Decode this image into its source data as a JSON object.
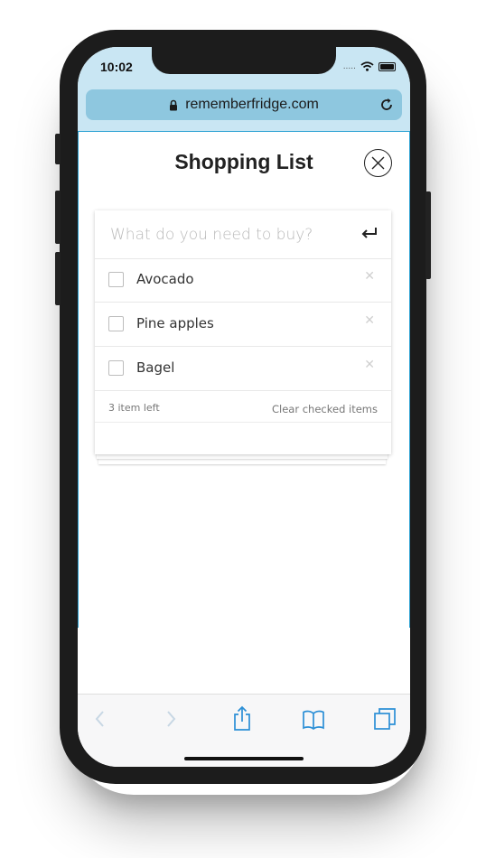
{
  "status_bar": {
    "time": "10:02",
    "signal_dots": "....."
  },
  "browser": {
    "url": "rememberfridge.com"
  },
  "app": {
    "title": "Shopping List",
    "new_item_placeholder": "What do you need to buy?",
    "items": [
      {
        "label": "Avocado",
        "checked": false
      },
      {
        "label": "Pine apples",
        "checked": false
      },
      {
        "label": "Bagel",
        "checked": false
      }
    ],
    "footer": {
      "items_left": "3 item left",
      "clear_label": "Clear checked items"
    }
  },
  "toolbar_icons": [
    "back-icon",
    "forward-icon",
    "share-icon",
    "bookmarks-icon",
    "tabs-icon"
  ],
  "colors": {
    "accent": "#2aa0d2",
    "url_bar": "#8ec7df",
    "status_bg": "#c9e6f3",
    "toolbar_icon": "#2b8fd6",
    "disabled_icon": "#c7d7e4"
  }
}
